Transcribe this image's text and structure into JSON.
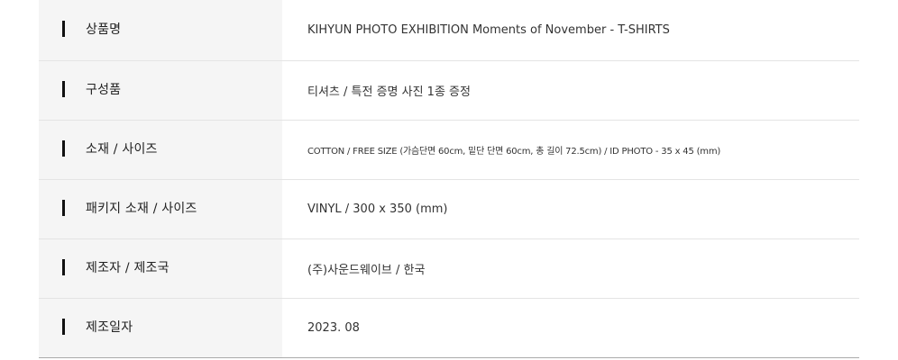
{
  "product_info": {
    "rows": [
      {
        "label": "상품명",
        "value": "KIHYUN PHOTO EXHIBITION Moments of November - T-SHIRTS"
      },
      {
        "label": "구성품",
        "value": "티셔츠 / 특전 증명 사진 1종 증정"
      },
      {
        "label": "소재 / 사이즈",
        "value": "COTTON / FREE SIZE (가슴단면 60cm, 밑단 단면 60cm, 총 길이 72.5cm) / ID PHOTO - 35 x 45 (mm)"
      },
      {
        "label": "패키지 소재 / 사이즈",
        "value": "VINYL / 300 x 350 (mm)"
      },
      {
        "label": "제조자 / 제조국",
        "value": "(주)사운드웨이브 / 한국"
      },
      {
        "label": "제조일자",
        "value": "2023. 08"
      }
    ]
  }
}
